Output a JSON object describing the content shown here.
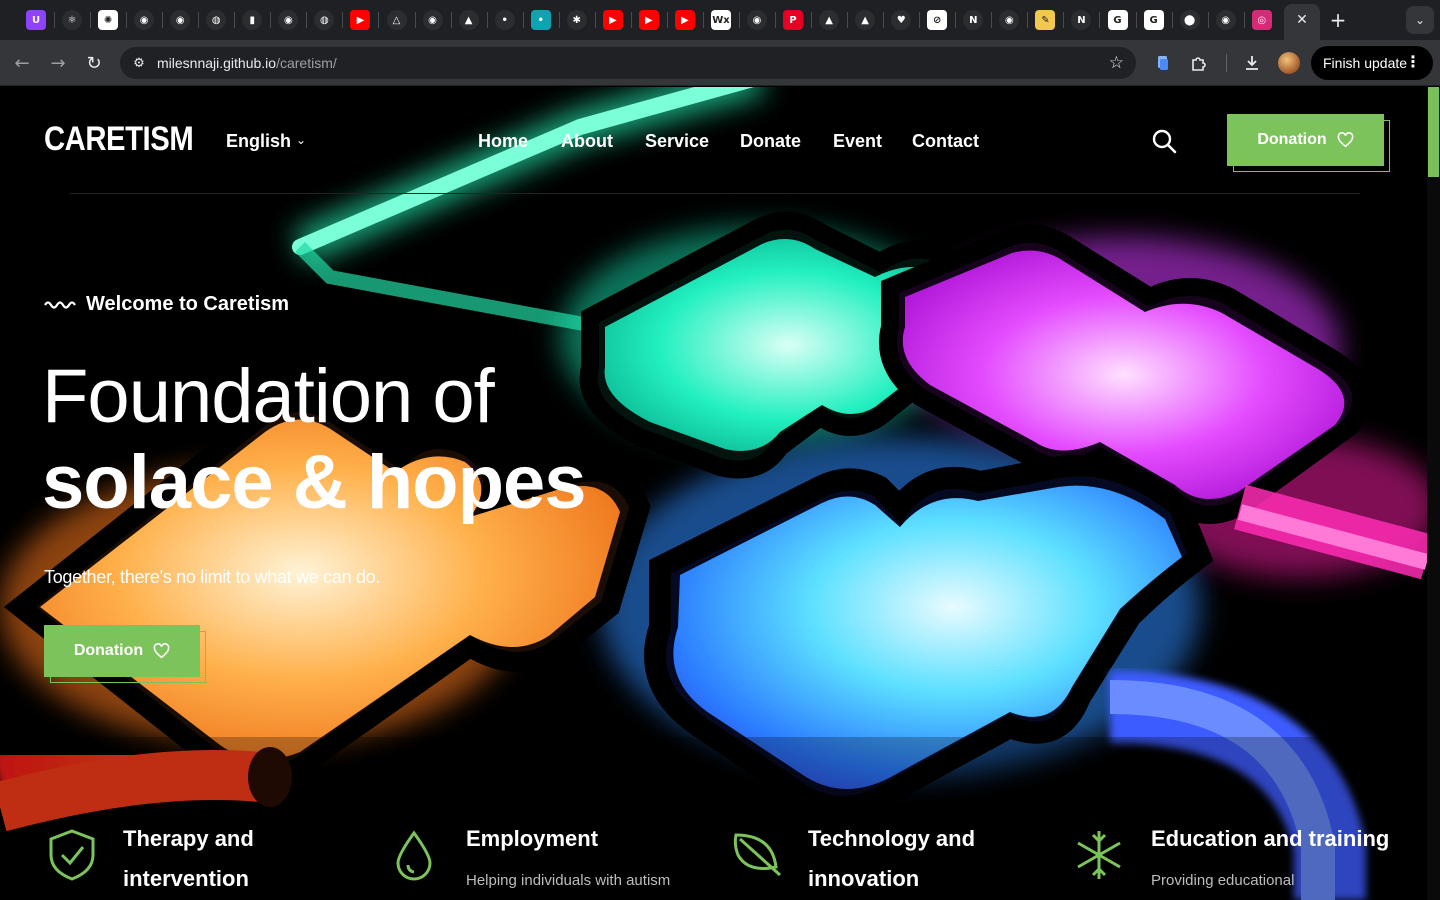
{
  "browser": {
    "url_host": "milesnnaji.github.io",
    "url_path": "/caretism/",
    "finish_update_label": "Finish update",
    "tabs": [
      {
        "icon": "uplabs-icon",
        "color": "#8e44ff"
      },
      {
        "icon": "react-icon",
        "color": "#2b2d31"
      },
      {
        "icon": "openai-icon",
        "color": "#ffffff"
      },
      {
        "icon": "github-icon",
        "color": "#2b2d31"
      },
      {
        "icon": "github-icon",
        "color": "#2b2d31"
      },
      {
        "icon": "globe-icon",
        "color": "#2b2d31"
      },
      {
        "icon": "bottle-icon",
        "color": "#2b2d31"
      },
      {
        "icon": "github-icon",
        "color": "#2b2d31"
      },
      {
        "icon": "globe-icon",
        "color": "#2b2d31"
      },
      {
        "icon": "youtube-icon",
        "color": "#ff0000"
      },
      {
        "icon": "drive-icon",
        "color": "#2b2d31"
      },
      {
        "icon": "github-icon",
        "color": "#2b2d31"
      },
      {
        "icon": "vercel-icon",
        "color": "#2b2d31"
      },
      {
        "icon": "site-icon",
        "color": "#2b2d31"
      },
      {
        "icon": "site-icon",
        "color": "#0fa3b1"
      },
      {
        "icon": "figure-icon",
        "color": "#2b2d31"
      },
      {
        "icon": "youtube-icon",
        "color": "#ff0000"
      },
      {
        "icon": "youtube-icon",
        "color": "#ff0000"
      },
      {
        "icon": "youtube-icon",
        "color": "#ff0000"
      },
      {
        "icon": "wix-icon",
        "color": "#ffffff"
      },
      {
        "icon": "github-icon",
        "color": "#2b2d31"
      },
      {
        "icon": "pinterest-icon",
        "color": "#e60023"
      },
      {
        "icon": "vercel-icon",
        "color": "#2b2d31"
      },
      {
        "icon": "vercel-icon",
        "color": "#2b2d31"
      },
      {
        "icon": "heart-icon",
        "color": "#2b2d31"
      },
      {
        "icon": "slash-icon",
        "color": "#ffffff"
      },
      {
        "icon": "n-icon",
        "color": "#2b2d31"
      },
      {
        "icon": "github-icon",
        "color": "#2b2d31"
      },
      {
        "icon": "pencil-icon",
        "color": "#f2c94c"
      },
      {
        "icon": "n-icon",
        "color": "#2b2d31"
      },
      {
        "icon": "google-icon",
        "color": "#ffffff"
      },
      {
        "icon": "google-icon",
        "color": "#ffffff"
      },
      {
        "icon": "maps-icon",
        "color": "#2b2d31"
      },
      {
        "icon": "github-icon",
        "color": "#2b2d31"
      },
      {
        "icon": "instagram-icon",
        "color": "#d62976"
      }
    ]
  },
  "site": {
    "logo": "CARETISM",
    "language": "English",
    "nav": [
      "Home",
      "About",
      "Service",
      "Donate",
      "Event",
      "Contact"
    ],
    "header_button": "Donation",
    "welcome": "Welcome to Caretism",
    "title_line1": "Foundation of",
    "title_line2": "solace & hopes",
    "tagline": "Together, there's no limit to what we can do.",
    "hero_button": "Donation",
    "accent_color": "#7dc35b",
    "features": [
      {
        "icon": "shield-check-icon",
        "title": "Therapy and intervention",
        "desc": ""
      },
      {
        "icon": "water-drop-icon",
        "title": "Employment",
        "desc": "Helping individuals with autism"
      },
      {
        "icon": "leaf-icon",
        "title": "Technology and innovation",
        "desc": ""
      },
      {
        "icon": "snowflake-icon",
        "title": "Education and training",
        "desc": "Providing educational"
      }
    ]
  }
}
